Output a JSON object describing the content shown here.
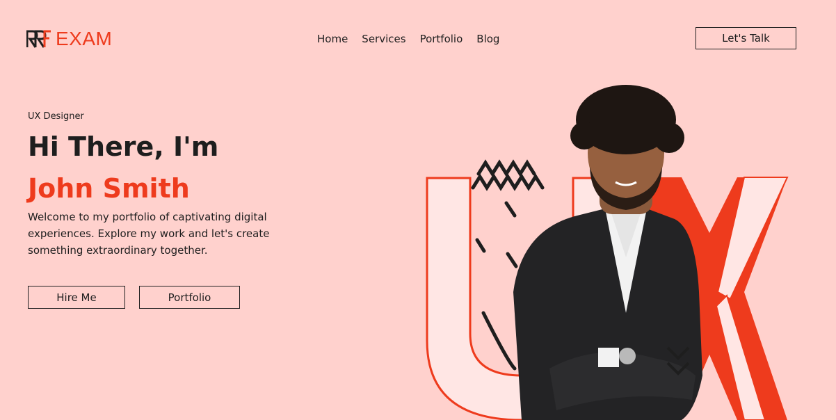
{
  "brand": {
    "logo_text": "EXAM",
    "logo_mark_icon": "rrf-monogram-icon",
    "accent": "#ee3b1d"
  },
  "nav": {
    "items": [
      "Home",
      "Services",
      "Portfolio",
      "Blog"
    ]
  },
  "header": {
    "cta_label": "Let's Talk"
  },
  "hero": {
    "role": "UX Designer",
    "greeting": "Hi There, I'm",
    "name": "John Smith",
    "intro": "Welcome to my portfolio of captivating digital experiences. Explore my work and let's create something extraordinary together.",
    "primary_button": "Hire Me",
    "secondary_button": "Portfolio",
    "art_letters": "UX"
  },
  "colors": {
    "background": "#ffd1cd",
    "text": "#1e1e1e",
    "accent": "#ee3b1d",
    "letter_fill": "#ffe6e4"
  }
}
